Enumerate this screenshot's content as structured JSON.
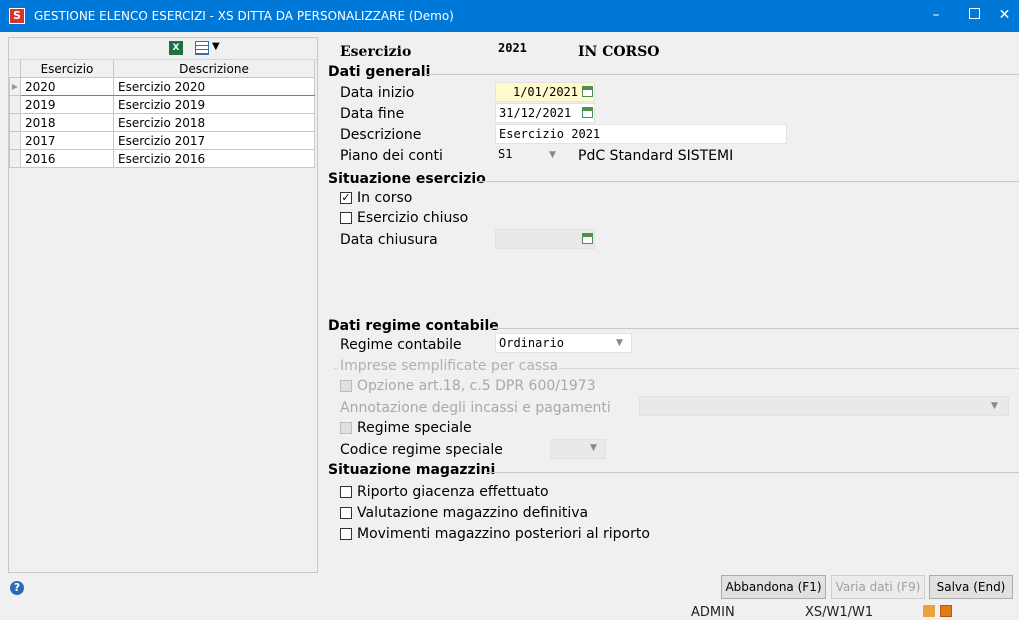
{
  "window": {
    "title": "GESTIONE ELENCO ESERCIZI - XS DITTA DA PERSONALIZZARE (Demo)",
    "minimize_glyph": "–",
    "close_glyph": "✕"
  },
  "grid": {
    "columns": [
      "Esercizio",
      "Descrizione"
    ],
    "rows": [
      {
        "esercizio": "2020",
        "descrizione": "Esercizio 2020"
      },
      {
        "esercizio": "2019",
        "descrizione": "Esercizio 2019"
      },
      {
        "esercizio": "2018",
        "descrizione": "Esercizio 2018"
      },
      {
        "esercizio": "2017",
        "descrizione": "Esercizio 2017"
      },
      {
        "esercizio": "2016",
        "descrizione": "Esercizio 2016"
      }
    ],
    "selected_index": 0
  },
  "header": {
    "esercizio_label": "Esercizio",
    "esercizio_value": "2021",
    "status": "IN CORSO"
  },
  "dati_generali": {
    "title": "Dati generali",
    "data_inizio_label": "Data inizio",
    "data_inizio": "1/01/2021",
    "data_fine_label": "Data fine",
    "data_fine": "31/12/2021",
    "descrizione_label": "Descrizione",
    "descrizione": "Esercizio 2021",
    "piano_label": "Piano dei conti",
    "piano_code": "S1",
    "piano_desc": "PdC Standard SISTEMI"
  },
  "situazione_esercizio": {
    "title": "Situazione esercizio",
    "in_corso_label": "In corso",
    "in_corso_checked": true,
    "chiuso_label": "Esercizio chiuso",
    "chiuso_checked": false,
    "data_chiusura_label": "Data chiusura"
  },
  "regime": {
    "title": "Dati regime contabile",
    "regime_label": "Regime contabile",
    "regime_value": "Ordinario",
    "semplificate_title": "Imprese semplificate per cassa",
    "opzione_label": "Opzione art.18, c.5 DPR 600/1973",
    "annotazione_label": "Annotazione degli incassi e pagamenti",
    "speciale_label": "Regime speciale",
    "codice_speciale_label": "Codice regime speciale"
  },
  "magazzini": {
    "title": "Situazione magazzini",
    "riporto_label": "Riporto giacenza effettuato",
    "valutazione_label": "Valutazione magazzino definitiva",
    "movimenti_label": "Movimenti magazzino posteriori al riporto"
  },
  "buttons": {
    "abbandona": "Abbandona (F1)",
    "varia": "Varia dati (F9)",
    "salva": "Salva (End)"
  },
  "statusbar": {
    "user": "ADMIN",
    "workstation": "XS/W1/W1"
  },
  "colors": {
    "titlebar": "#0078d7",
    "mandatory_field": "#fffbcc"
  }
}
